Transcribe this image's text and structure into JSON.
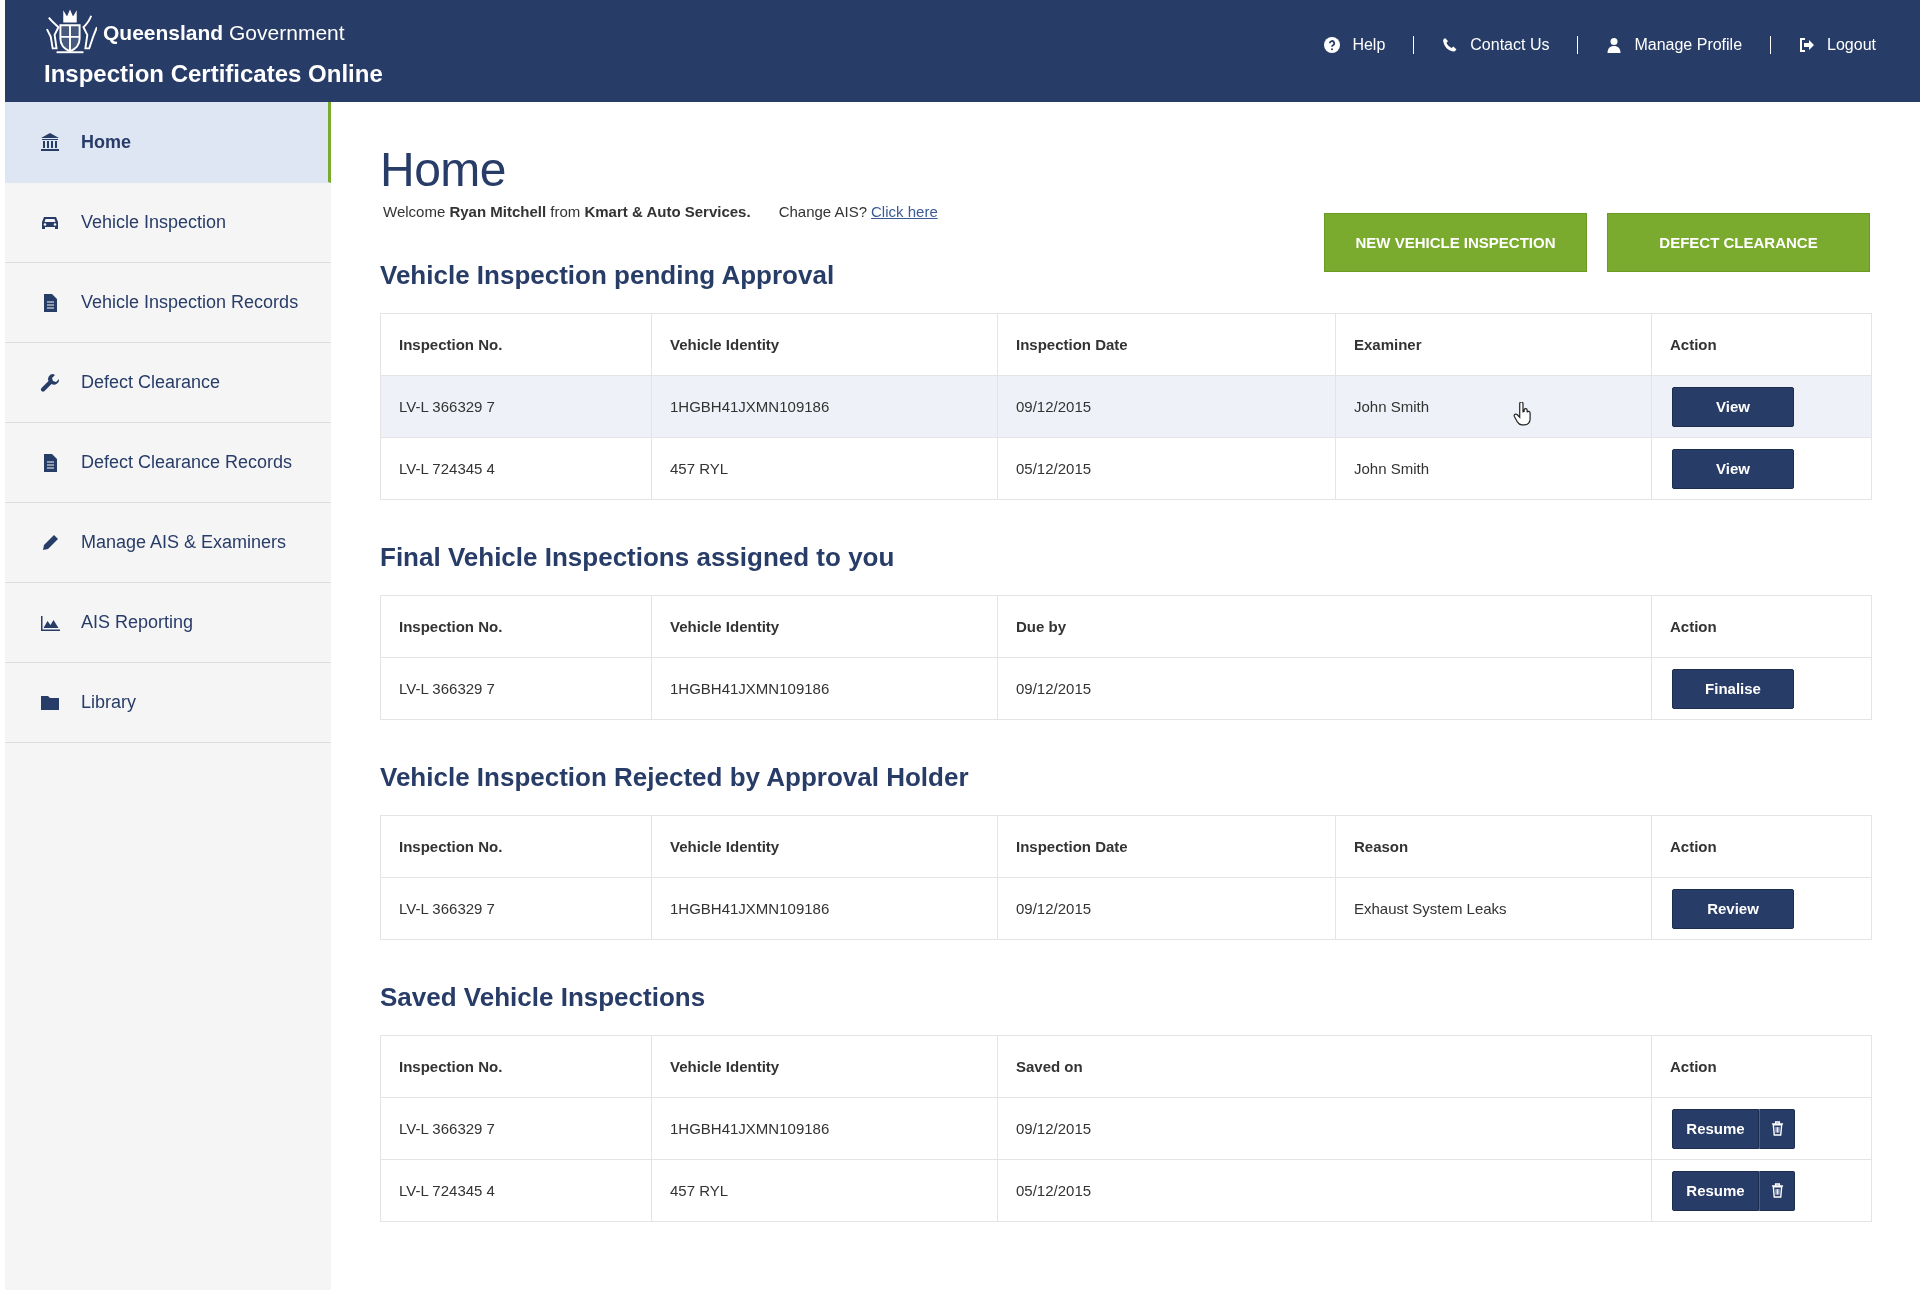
{
  "header": {
    "brand_bold": "Queensland",
    "brand_light": "Government",
    "app_title": "Inspection Certificates Online",
    "nav": [
      {
        "kind": "help",
        "label": "Help"
      },
      {
        "kind": "phone",
        "label": "Contact Us"
      },
      {
        "kind": "user",
        "label": "Manage Profile"
      },
      {
        "kind": "logout",
        "label": "Logout"
      }
    ]
  },
  "sidebar": {
    "items": [
      {
        "kind": "home",
        "label": "Home",
        "selected": true
      },
      {
        "kind": "car",
        "label": "Vehicle Inspection",
        "selected": false
      },
      {
        "kind": "document",
        "label": "Vehicle Inspection Records",
        "selected": false
      },
      {
        "kind": "wrench",
        "label": "Defect Clearance",
        "selected": false
      },
      {
        "kind": "document",
        "label": "Defect Clearance Records",
        "selected": false
      },
      {
        "kind": "pencil",
        "label": "Manage AIS & Examiners",
        "selected": false
      },
      {
        "kind": "chart",
        "label": "AIS Reporting",
        "selected": false
      },
      {
        "kind": "folder",
        "label": "Library",
        "selected": false
      }
    ]
  },
  "page": {
    "title": "Home",
    "welcome": "Welcome **Ryan Mitchell** from **Kmart & Auto Services.**",
    "change_ais": "Change AIS?",
    "change_link": "Click here",
    "buttons": [
      "NEW VEHICLE INSPECTION",
      "DEFECT CLEARANCE"
    ]
  },
  "sections": [
    {
      "title": "Vehicle Inspection pending Approval",
      "columns": [
        "Inspection No.",
        "Vehicle Identity",
        "Inspection Date",
        "Examiner",
        "Action"
      ],
      "rows": [
        {
          "cells": [
            "LV-L 366329 7",
            "1HGBH41JXMN109186",
            "09/12/2015",
            "John Smith"
          ],
          "action": "View",
          "deletable": false,
          "selected": true
        },
        {
          "cells": [
            "LV-L 724345 4",
            "457 RYL",
            "05/12/2015",
            "John Smith"
          ],
          "action": "View",
          "deletable": false,
          "selected": false
        }
      ]
    },
    {
      "title": "Final Vehicle Inspections assigned to you",
      "columns": [
        "Inspection No.",
        "Vehicle Identity",
        "Due by",
        "Action"
      ],
      "rows": [
        {
          "cells": [
            "LV-L 366329 7",
            "1HGBH41JXMN109186",
            "09/12/2015"
          ],
          "action": "Finalise",
          "deletable": false,
          "selected": false
        }
      ]
    },
    {
      "title": "Vehicle Inspection Rejected by Approval Holder",
      "columns": [
        "Inspection No.",
        "Vehicle Identity",
        "Inspection Date",
        "Reason",
        "Action"
      ],
      "rows": [
        {
          "cells": [
            "LV-L 366329 7",
            "1HGBH41JXMN109186",
            "09/12/2015",
            "Exhaust System Leaks"
          ],
          "action": "Review",
          "deletable": false,
          "selected": false
        }
      ]
    },
    {
      "title": "Saved Vehicle Inspections",
      "columns": [
        "Inspection No.",
        "Vehicle Identity",
        "Saved on",
        "Action"
      ],
      "rows": [
        {
          "cells": [
            "LV-L 366329 7",
            "1HGBH41JXMN109186",
            "09/12/2015"
          ],
          "action": "Resume",
          "deletable": true,
          "selected": false
        },
        {
          "cells": [
            "LV-L 724345 4",
            "457 RYL",
            "05/12/2015"
          ],
          "action": "Resume",
          "deletable": true,
          "selected": false
        }
      ]
    }
  ]
}
